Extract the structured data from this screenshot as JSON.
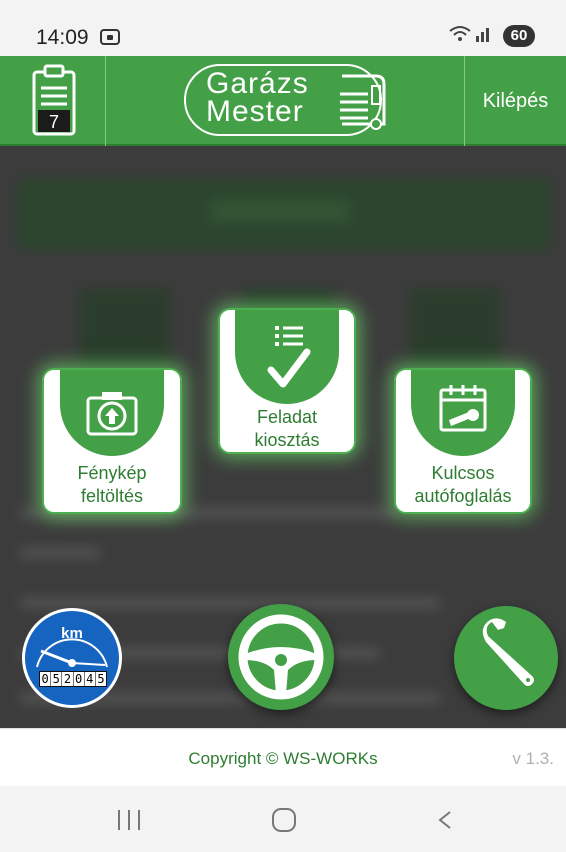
{
  "status_bar": {
    "time": "14:09",
    "battery": "60",
    "icons": [
      "screenshot-icon",
      "wifi-icon",
      "signal-icon",
      "battery-icon"
    ]
  },
  "header": {
    "calendar_day": "7",
    "logo_line1": "Garázs",
    "logo_line2": "Mester",
    "logout_label": "Kilépés",
    "color": "#43a047"
  },
  "menu": {
    "photo_upload": {
      "line1": "Fénykép",
      "line2": "feltöltés",
      "icon": "camera-upload-icon"
    },
    "task_assign": {
      "line1": "Feladat",
      "line2": "kiosztás",
      "icon": "checklist-icon"
    },
    "key_booking": {
      "line1": "Kulcsos",
      "line2": "autófoglalás",
      "icon": "calendar-key-icon"
    }
  },
  "fabs": {
    "km": {
      "label": "km",
      "odometer": [
        "0",
        "5",
        "2",
        "0",
        "4",
        "5"
      ],
      "color": "#1565c0"
    },
    "steering": {
      "icon": "steering-wheel-icon"
    },
    "service": {
      "icon": "wrench-icon"
    }
  },
  "footer": {
    "copyright": "Copyright © WS-WORKs",
    "version": "v 1.3."
  },
  "accent_color": "#2e7d32"
}
